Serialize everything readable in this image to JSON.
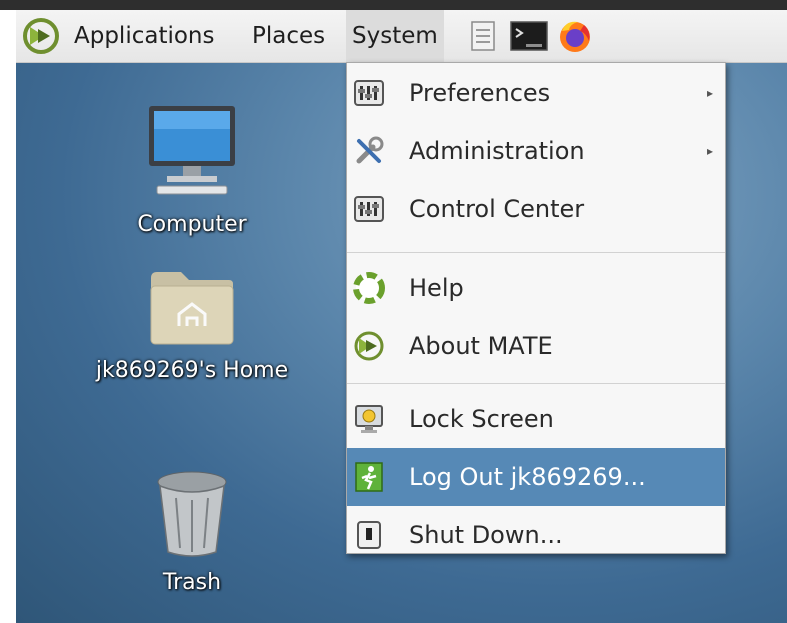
{
  "panel": {
    "menus": [
      "Applications",
      "Places",
      "System"
    ],
    "launchers": [
      "text-editor-icon",
      "terminal-icon",
      "firefox-icon"
    ]
  },
  "desktop": {
    "icons": [
      {
        "label": "Computer",
        "icon": "computer-icon"
      },
      {
        "label": "jk869269's Home",
        "icon": "home-folder-icon"
      },
      {
        "label": "Trash",
        "icon": "trash-icon"
      }
    ]
  },
  "system_menu": {
    "items": [
      {
        "label": "Preferences",
        "icon": "preferences-icon",
        "has_submenu": true
      },
      {
        "label": "Administration",
        "icon": "administration-icon",
        "has_submenu": true
      },
      {
        "label": "Control Center",
        "icon": "control-center-icon"
      },
      {
        "label": "Help",
        "icon": "help-icon"
      },
      {
        "label": "About MATE",
        "icon": "mate-logo-icon"
      },
      {
        "label": "Lock Screen",
        "icon": "lock-screen-icon"
      },
      {
        "label": "Log Out jk869269...",
        "icon": "log-out-icon",
        "selected": true
      },
      {
        "label": "Shut Down...",
        "icon": "shut-down-icon"
      }
    ],
    "submenu_arrow": "▸"
  },
  "colors": {
    "selection": "#5689b6",
    "menu_bg": "#f7f7f7",
    "panel_bg": "#eeeeee",
    "desktop_bg": "#4a7aa3"
  }
}
